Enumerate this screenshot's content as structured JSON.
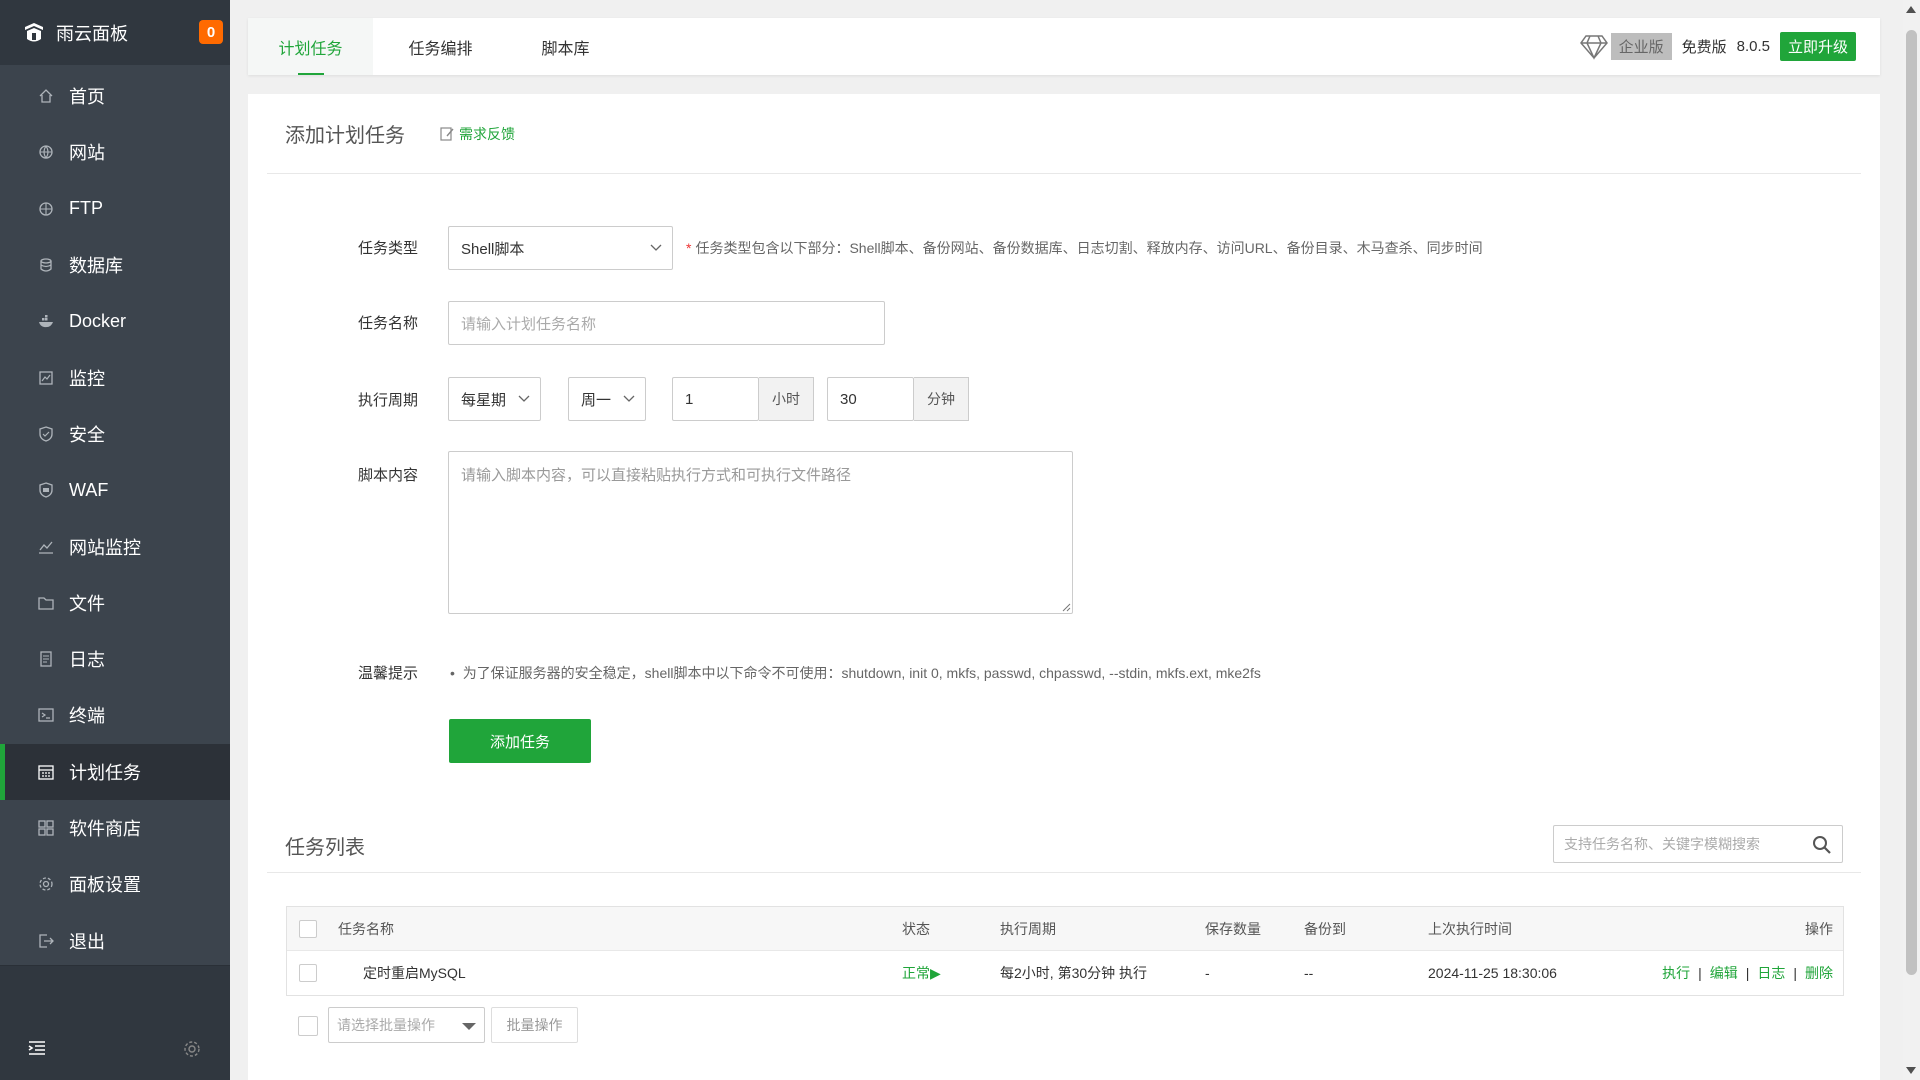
{
  "sidebar": {
    "brand": "雨云面板",
    "badge": "0",
    "items": [
      {
        "label": "首页",
        "icon": "home-icon"
      },
      {
        "label": "网站",
        "icon": "globe-icon"
      },
      {
        "label": "FTP",
        "icon": "ftp-icon"
      },
      {
        "label": "数据库",
        "icon": "database-icon"
      },
      {
        "label": "Docker",
        "icon": "docker-icon"
      },
      {
        "label": "监控",
        "icon": "monitor-icon"
      },
      {
        "label": "安全",
        "icon": "shield-icon"
      },
      {
        "label": "WAF",
        "icon": "waf-icon"
      },
      {
        "label": "网站监控",
        "icon": "chart-icon"
      },
      {
        "label": "文件",
        "icon": "folder-icon"
      },
      {
        "label": "日志",
        "icon": "log-icon"
      },
      {
        "label": "终端",
        "icon": "terminal-icon"
      },
      {
        "label": "计划任务",
        "icon": "calendar-icon"
      },
      {
        "label": "软件商店",
        "icon": "grid-icon"
      },
      {
        "label": "面板设置",
        "icon": "gear-icon"
      },
      {
        "label": "退出",
        "icon": "logout-icon"
      }
    ],
    "active_index": 12
  },
  "topbar": {
    "tabs": [
      "计划任务",
      "任务编排",
      "脚本库"
    ],
    "enterprise": "企业版",
    "edition": "免费版",
    "version": "8.0.5",
    "upgrade": "立即升级"
  },
  "form": {
    "title": "添加计划任务",
    "feedback": "需求反馈",
    "type_label": "任务类型",
    "type_value": "Shell脚本",
    "type_hint": "任务类型包含以下部分：Shell脚本、备份网站、备份数据库、日志切割、释放内存、访问URL、备份目录、木马查杀、同步时间",
    "name_label": "任务名称",
    "name_placeholder": "请输入计划任务名称",
    "cycle_label": "执行周期",
    "cycle_type": "每星期",
    "cycle_day": "周一",
    "hour_value": "1",
    "hour_unit": "小时",
    "minute_value": "30",
    "minute_unit": "分钟",
    "script_label": "脚本内容",
    "script_placeholder": "请输入脚本内容，可以直接粘贴执行方式和可执行文件路径",
    "tip_label": "温馨提示",
    "tip_text": "为了保证服务器的安全稳定，shell脚本中以下命令不可使用：shutdown, init 0, mkfs, passwd, chpasswd, --stdin, mkfs.ext, mke2fs",
    "submit": "添加任务"
  },
  "list": {
    "title": "任务列表",
    "search_placeholder": "支持任务名称、关键字模糊搜索",
    "columns": {
      "name": "任务名称",
      "status": "状态",
      "cycle": "执行周期",
      "keep": "保存数量",
      "backup": "备份到",
      "last": "上次执行时间",
      "ops": "操作"
    },
    "rows": [
      {
        "name": "定时重启MySQL",
        "status": "正常▶",
        "cycle": "每2小时, 第30分钟 执行",
        "keep": "-",
        "backup": "--",
        "last": "2024-11-25 18:30:06",
        "op_run": "执行",
        "op_edit": "编辑",
        "op_log": "日志",
        "op_delete": "删除"
      }
    ],
    "batch_placeholder": "请选择批量操作",
    "batch_button": "批量操作"
  },
  "colors": {
    "accent": "#20a53a",
    "sidebar_bg": "#3c444d",
    "badge": "#ff6a00"
  }
}
